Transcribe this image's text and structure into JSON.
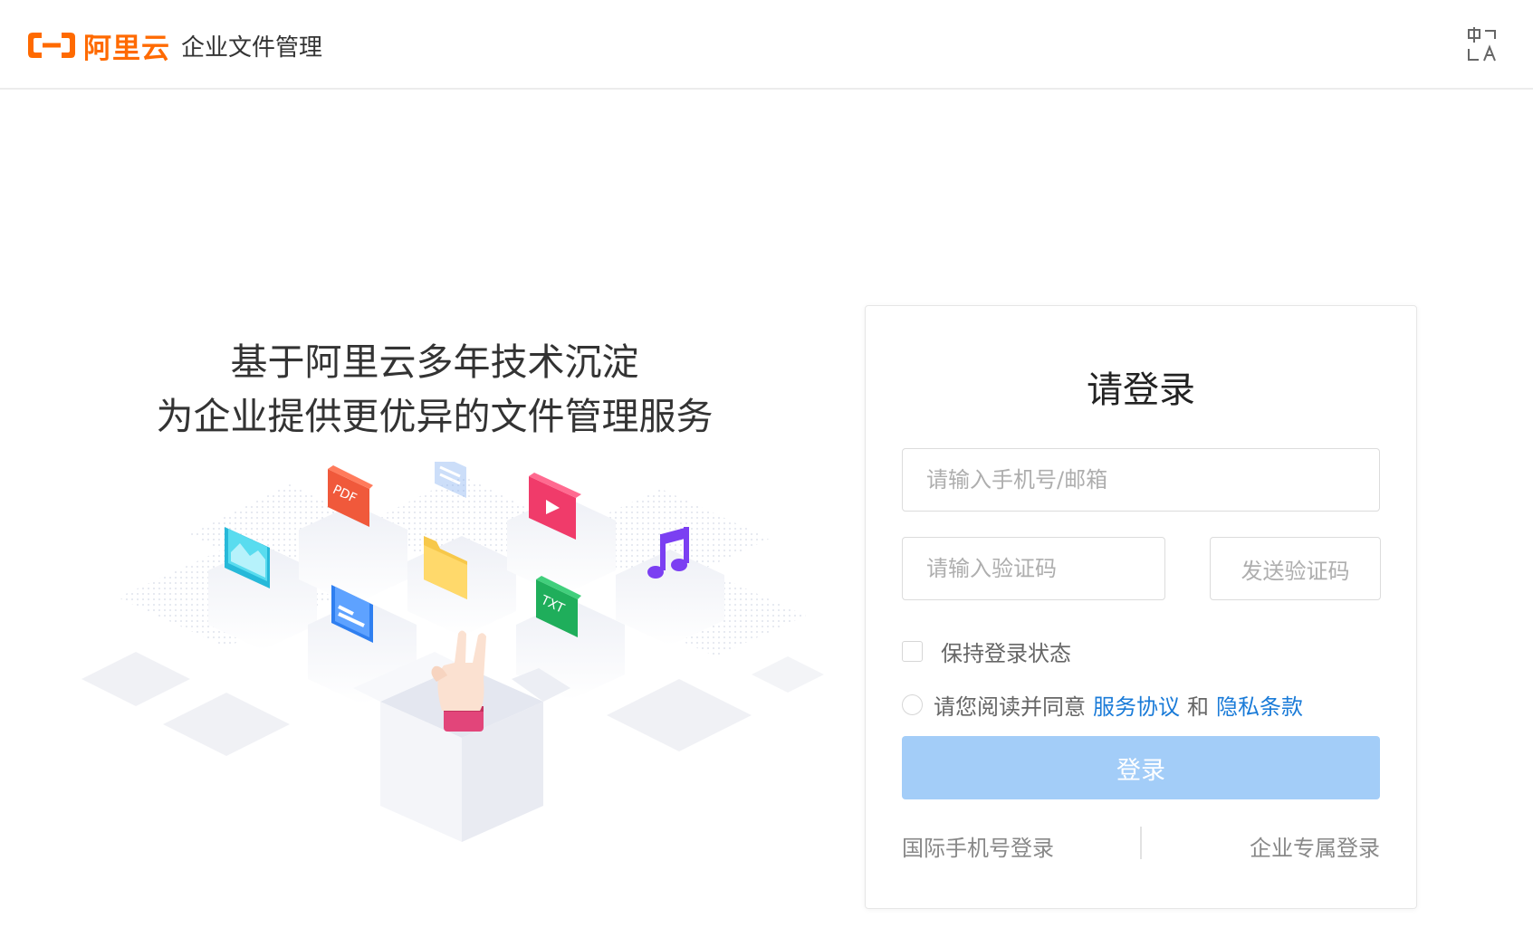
{
  "header": {
    "brand_name": "阿里云",
    "product_name": "企业文件管理",
    "lang_icon": "language-switch-icon"
  },
  "hero": {
    "slogan_line1": "基于阿里云多年技术沉淀",
    "slogan_line2": "为企业提供更优异的文件管理服务",
    "file_badges": {
      "pdf": "PDF",
      "txt": "TXT"
    }
  },
  "login": {
    "title": "请登录",
    "account_placeholder": "请输入手机号/邮箱",
    "code_placeholder": "请输入验证码",
    "send_code_label": "发送验证码",
    "remember_label": "保持登录状态",
    "agree_prefix": "请您阅读并同意",
    "service_agreement": "服务协议",
    "agree_and": "和",
    "privacy_policy": "隐私条款",
    "submit_label": "登录",
    "intl_login": "国际手机号登录",
    "enterprise_login": "企业专属登录"
  },
  "colors": {
    "brand": "#ff6a00",
    "link": "#1a7bd8",
    "button_disabled": "#a3cdf8"
  }
}
